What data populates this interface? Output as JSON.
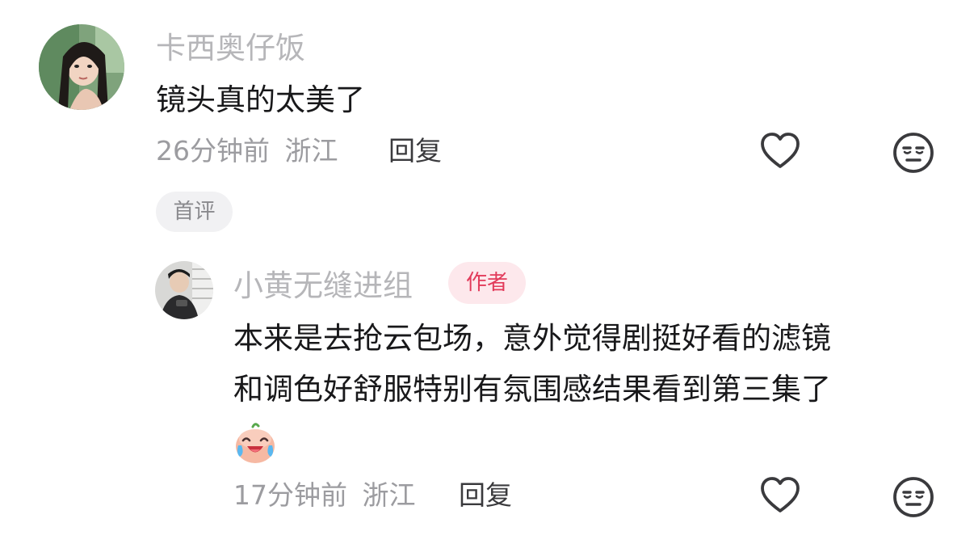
{
  "comment": {
    "username": "卡西奥仔饭",
    "text": "镜头真的太美了",
    "time": "26分钟前",
    "location": "浙江",
    "reply_label": "回复",
    "tag": "首评"
  },
  "reply": {
    "username": "小黄无缝进组",
    "badge": "作者",
    "text_line1": "本来是去抢云包场，意外觉得剧挺好看的滤镜",
    "text_line2": "和调色好舒服特别有氛围感结果看到第三集了",
    "emoji": "laugh-cry-emoji",
    "time": "17分钟前",
    "location": "浙江",
    "reply_label": "回复"
  },
  "icons": {
    "like": "heart-icon",
    "dislike": "unamused-face-icon"
  },
  "colors": {
    "username": "#b6b6b9",
    "text": "#18181a",
    "meta": "#9c9ca0",
    "author_badge_bg": "#fde8ec",
    "author_badge_text": "#e23a5a",
    "tag_bg": "#f1f1f3"
  }
}
